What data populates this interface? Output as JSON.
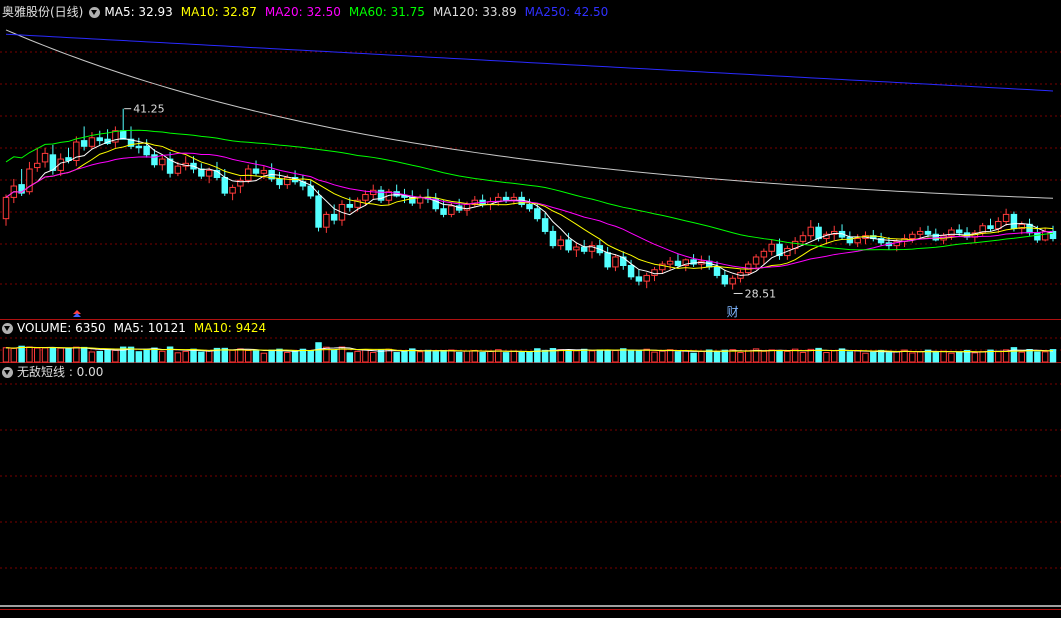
{
  "header": {
    "stock": "奥雅股份(日线)",
    "ma_items": [
      {
        "label": "MA5: 32.93",
        "color": "#ffffff"
      },
      {
        "label": "MA10: 32.87",
        "color": "#ffff00"
      },
      {
        "label": "MA20: 32.50",
        "color": "#ff00ff"
      },
      {
        "label": "MA60: 31.75",
        "color": "#00ff00"
      },
      {
        "label": "MA120: 33.89",
        "color": "#dddddd"
      },
      {
        "label": "MA250: 42.50",
        "color": "#3030ff"
      }
    ]
  },
  "volume_header": {
    "items": [
      {
        "label": "VOLUME: 6350",
        "color": "#ffffff"
      },
      {
        "label": "MA5: 10121",
        "color": "#ffffff"
      },
      {
        "label": "MA10: 9424",
        "color": "#ffff00"
      }
    ]
  },
  "indicator_header": {
    "label": "无敌短线 : 0.00",
    "color": "#dddddd"
  },
  "annotations": {
    "high_label": "41.25",
    "low_label": "28.51",
    "event_marker": "财"
  },
  "colors": {
    "up": "#ff3b3b",
    "down": "#54ffff",
    "grid": "#7a0000",
    "panel_border": "#b01010",
    "ma5": "#ffffff",
    "ma10": "#ffff00",
    "ma20": "#ff00ff",
    "ma60": "#00ff00",
    "ma120": "#c8c8c8",
    "ma250": "#2a2aff"
  },
  "chart_data": {
    "type": "candlestick",
    "price_range": [
      26.5,
      47.5
    ],
    "bars": 180,
    "candles": [
      [
        33.5,
        35.2,
        33.0,
        35.0
      ],
      [
        35.0,
        36.3,
        34.6,
        35.8
      ],
      [
        35.9,
        37.0,
        35.1,
        35.3
      ],
      [
        35.4,
        37.5,
        35.2,
        37.0
      ],
      [
        37.1,
        38.5,
        36.8,
        37.4
      ],
      [
        37.5,
        38.5,
        37.1,
        38.1
      ],
      [
        38.0,
        38.7,
        36.6,
        36.9
      ],
      [
        36.9,
        38.1,
        36.5,
        37.7
      ],
      [
        37.8,
        38.5,
        37.4,
        37.6
      ],
      [
        37.6,
        39.3,
        37.2,
        38.9
      ],
      [
        39.0,
        40.0,
        38.3,
        38.6
      ],
      [
        38.6,
        39.6,
        38.4,
        39.2
      ],
      [
        39.2,
        39.7,
        38.7,
        39.0
      ],
      [
        39.1,
        39.8,
        38.7,
        38.8
      ],
      [
        38.9,
        40.0,
        38.5,
        39.7
      ],
      [
        39.7,
        41.25,
        39.3,
        39.1
      ],
      [
        39.1,
        40.0,
        38.4,
        38.6
      ],
      [
        38.6,
        39.2,
        38.1,
        38.5
      ],
      [
        38.6,
        39.1,
        37.8,
        38.0
      ],
      [
        38.0,
        38.4,
        37.1,
        37.3
      ],
      [
        37.3,
        38.0,
        36.9,
        37.7
      ],
      [
        37.7,
        38.2,
        36.4,
        36.7
      ],
      [
        36.7,
        37.5,
        36.5,
        37.2
      ],
      [
        37.2,
        37.9,
        36.9,
        37.4
      ],
      [
        37.4,
        37.9,
        36.7,
        37.0
      ],
      [
        37.0,
        37.4,
        36.3,
        36.5
      ],
      [
        36.5,
        37.1,
        36.0,
        36.9
      ],
      [
        36.9,
        37.5,
        36.2,
        36.4
      ],
      [
        36.4,
        37.0,
        35.1,
        35.3
      ],
      [
        35.3,
        35.9,
        34.8,
        35.7
      ],
      [
        35.8,
        36.4,
        35.3,
        36.2
      ],
      [
        36.2,
        37.3,
        36.0,
        37.0
      ],
      [
        37.0,
        37.6,
        36.5,
        36.7
      ],
      [
        36.7,
        37.2,
        36.3,
        36.9
      ],
      [
        36.9,
        37.4,
        36.1,
        36.3
      ],
      [
        36.3,
        36.8,
        35.6,
        35.9
      ],
      [
        35.9,
        36.6,
        35.6,
        36.4
      ],
      [
        36.4,
        36.9,
        35.9,
        36.1
      ],
      [
        36.1,
        36.6,
        35.5,
        35.8
      ],
      [
        35.8,
        36.2,
        34.9,
        35.1
      ],
      [
        35.1,
        35.5,
        32.6,
        32.9
      ],
      [
        32.9,
        34.0,
        32.5,
        33.8
      ],
      [
        33.8,
        34.5,
        33.1,
        33.4
      ],
      [
        33.4,
        34.8,
        33.0,
        34.5
      ],
      [
        34.5,
        35.0,
        34.0,
        34.3
      ],
      [
        34.3,
        35.0,
        34.0,
        34.8
      ],
      [
        34.8,
        35.5,
        34.4,
        35.2
      ],
      [
        35.2,
        35.9,
        34.9,
        35.5
      ],
      [
        35.5,
        35.8,
        34.6,
        34.8
      ],
      [
        34.8,
        35.6,
        34.5,
        35.4
      ],
      [
        35.4,
        35.9,
        35.0,
        35.1
      ],
      [
        35.1,
        35.6,
        34.6,
        35.0
      ],
      [
        35.0,
        35.5,
        34.4,
        34.6
      ],
      [
        34.6,
        35.2,
        34.2,
        35.0
      ],
      [
        35.0,
        35.6,
        34.6,
        34.9
      ],
      [
        34.9,
        35.3,
        34.0,
        34.2
      ],
      [
        34.2,
        34.8,
        33.6,
        33.8
      ],
      [
        33.8,
        34.6,
        33.6,
        34.4
      ],
      [
        34.4,
        34.9,
        33.9,
        34.1
      ],
      [
        34.1,
        34.7,
        33.7,
        34.5
      ],
      [
        34.5,
        35.1,
        34.3,
        34.8
      ],
      [
        34.8,
        35.2,
        34.3,
        34.5
      ],
      [
        34.5,
        35.0,
        34.1,
        34.7
      ],
      [
        34.7,
        35.3,
        34.4,
        35.0
      ],
      [
        35.0,
        35.4,
        34.6,
        34.8
      ],
      [
        34.8,
        35.3,
        34.5,
        35.0
      ],
      [
        35.0,
        35.4,
        34.3,
        34.5
      ],
      [
        34.5,
        34.9,
        34.0,
        34.2
      ],
      [
        34.2,
        34.6,
        33.3,
        33.5
      ],
      [
        33.5,
        33.9,
        32.4,
        32.6
      ],
      [
        32.6,
        33.0,
        31.4,
        31.6
      ],
      [
        31.6,
        32.3,
        31.3,
        32.0
      ],
      [
        32.0,
        32.5,
        31.1,
        31.3
      ],
      [
        31.3,
        31.8,
        30.8,
        31.5
      ],
      [
        31.5,
        32.0,
        31.0,
        31.2
      ],
      [
        31.2,
        31.9,
        30.7,
        31.6
      ],
      [
        31.6,
        32.0,
        30.9,
        31.1
      ],
      [
        31.1,
        31.5,
        29.9,
        30.1
      ],
      [
        30.1,
        31.0,
        29.8,
        30.8
      ],
      [
        30.8,
        31.2,
        29.9,
        30.2
      ],
      [
        30.2,
        30.6,
        29.2,
        29.4
      ],
      [
        29.4,
        29.9,
        28.8,
        29.1
      ],
      [
        29.1,
        29.7,
        28.6,
        29.5
      ],
      [
        29.5,
        30.1,
        29.1,
        29.9
      ],
      [
        29.9,
        30.5,
        29.6,
        30.3
      ],
      [
        30.3,
        30.8,
        29.9,
        30.5
      ],
      [
        30.5,
        31.0,
        30.0,
        30.2
      ],
      [
        30.2,
        30.7,
        29.8,
        30.6
      ],
      [
        30.6,
        31.0,
        30.1,
        30.3
      ],
      [
        30.3,
        30.9,
        29.9,
        30.5
      ],
      [
        30.5,
        30.9,
        29.9,
        30.1
      ],
      [
        30.1,
        30.5,
        29.3,
        29.5
      ],
      [
        29.5,
        29.9,
        28.7,
        28.9
      ],
      [
        28.9,
        29.5,
        28.51,
        29.3
      ],
      [
        29.3,
        29.9,
        29.0,
        29.7
      ],
      [
        29.7,
        30.5,
        29.5,
        30.3
      ],
      [
        30.3,
        31.0,
        29.9,
        30.8
      ],
      [
        30.8,
        31.4,
        30.3,
        31.2
      ],
      [
        31.2,
        32.0,
        30.9,
        31.7
      ],
      [
        31.7,
        32.1,
        30.6,
        30.9
      ],
      [
        30.9,
        31.6,
        30.6,
        31.4
      ],
      [
        31.4,
        32.2,
        31.0,
        31.9
      ],
      [
        31.9,
        32.6,
        31.6,
        32.3
      ],
      [
        32.3,
        33.4,
        32.0,
        32.9
      ],
      [
        32.9,
        33.2,
        31.9,
        32.1
      ],
      [
        32.1,
        32.6,
        31.7,
        32.4
      ],
      [
        32.4,
        33.0,
        32.0,
        32.6
      ],
      [
        32.6,
        33.1,
        32.0,
        32.2
      ],
      [
        32.2,
        32.6,
        31.6,
        31.8
      ],
      [
        31.8,
        32.4,
        31.5,
        32.1
      ],
      [
        32.1,
        32.6,
        31.7,
        32.3
      ],
      [
        32.3,
        32.7,
        31.9,
        32.1
      ],
      [
        32.1,
        32.5,
        31.6,
        31.8
      ],
      [
        31.8,
        32.2,
        31.3,
        31.6
      ],
      [
        31.6,
        32.1,
        31.2,
        31.9
      ],
      [
        31.9,
        32.4,
        31.5,
        32.1
      ],
      [
        32.1,
        32.6,
        31.8,
        32.4
      ],
      [
        32.4,
        32.9,
        32.1,
        32.6
      ],
      [
        32.6,
        33.0,
        32.2,
        32.4
      ],
      [
        32.4,
        32.8,
        31.9,
        32.0
      ],
      [
        32.0,
        32.5,
        31.7,
        32.3
      ],
      [
        32.3,
        32.9,
        32.0,
        32.7
      ],
      [
        32.7,
        33.1,
        32.3,
        32.5
      ],
      [
        32.5,
        32.9,
        32.0,
        32.2
      ],
      [
        32.2,
        32.7,
        31.8,
        32.5
      ],
      [
        32.5,
        33.2,
        32.3,
        33.0
      ],
      [
        33.0,
        33.5,
        32.6,
        32.8
      ],
      [
        32.8,
        33.6,
        32.5,
        33.3
      ],
      [
        33.3,
        34.2,
        33.0,
        33.8
      ],
      [
        33.8,
        34.0,
        32.6,
        32.8
      ],
      [
        32.8,
        33.3,
        32.4,
        33.1
      ],
      [
        33.1,
        33.5,
        32.3,
        32.5
      ],
      [
        32.5,
        33.0,
        31.8,
        32.0
      ],
      [
        32.0,
        32.8,
        31.9,
        32.6
      ],
      [
        32.6,
        33.0,
        31.9,
        32.1
      ]
    ],
    "volume_ma": {
      "ma5": 10121,
      "ma10": 9424,
      "last": 6350
    },
    "indicator": {
      "name": "无敌短线",
      "value": 0.0,
      "spike_bar": 165
    }
  }
}
